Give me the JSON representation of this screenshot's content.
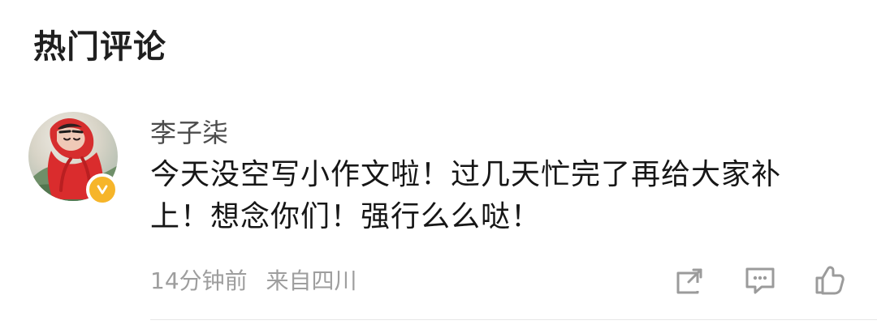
{
  "section": {
    "title": "热门评论"
  },
  "comment": {
    "username": "李子柒",
    "text": "今天没空写小作文啦！过几天忙完了再给大家补上！想念你们！强行么么哒！",
    "meta": {
      "time": "14分钟前",
      "source": "来自四川"
    },
    "actions": {
      "share_icon": "share-icon",
      "comment_icon": "comment-icon",
      "like_icon": "thumbs-up-icon"
    },
    "avatar": {
      "icon": "user-avatar",
      "verified_icon": "verified-badge-icon"
    }
  },
  "colors": {
    "title": "#1f1f1f",
    "username": "#4b4b4b",
    "comment_text": "#161616",
    "meta": "#9e9e9e",
    "verified_badge": "#f6b52a",
    "icon_stroke": "#9b9b9b",
    "divider": "#e7e7e7"
  }
}
